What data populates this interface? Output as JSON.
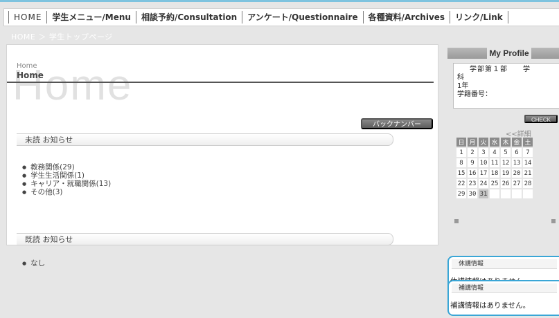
{
  "nav": {
    "items": [
      "HOME",
      "学生メニュー/Menu",
      "相談予約/Consultation",
      "アンケート/Questionnaire",
      "各種資料/Archives",
      "リンク/Link"
    ]
  },
  "breadcrumb": "HOME ＞ 学生トップページ",
  "main": {
    "home_big": "Home",
    "home_small": "Home",
    "home_heading": "Home",
    "back_number_label": "バックナンバー",
    "unread_title": "未読 お知らせ",
    "unread_items": [
      "教務関係(29)",
      "学生生活関係(1)",
      "キャリア・就職関係(13)",
      "その他(3)"
    ],
    "read_title": "既読 お知らせ",
    "read_items": [
      "なし"
    ]
  },
  "profile": {
    "title": "My Profile",
    "line1": "学部第１部　　学",
    "line2": "科",
    "line3": "1年",
    "line4": "学籍番号：",
    "check_label": "CHECK"
  },
  "calendar": {
    "detail_link": "<<詳細",
    "weekdays": [
      "日",
      "月",
      "火",
      "水",
      "木",
      "金",
      "土"
    ],
    "weeks": [
      [
        "1",
        "2",
        "3",
        "4",
        "5",
        "6",
        "7"
      ],
      [
        "8",
        "9",
        "10",
        "11",
        "12",
        "13",
        "14"
      ],
      [
        "15",
        "16",
        "17",
        "18",
        "19",
        "20",
        "21"
      ],
      [
        "22",
        "23",
        "24",
        "25",
        "26",
        "27",
        "28"
      ],
      [
        "29",
        "30",
        "31",
        "",
        "",
        "",
        ""
      ]
    ],
    "today": "31"
  },
  "cancel_info": {
    "title": "休講情報",
    "body": "休講情報はありません。"
  },
  "makeup_info": {
    "title": "補講情報",
    "body": "補講情報はありません。"
  },
  "colors": {
    "accent": "#3aa6d6",
    "topline": "#7ec3df",
    "background": "#e6e6e6"
  }
}
